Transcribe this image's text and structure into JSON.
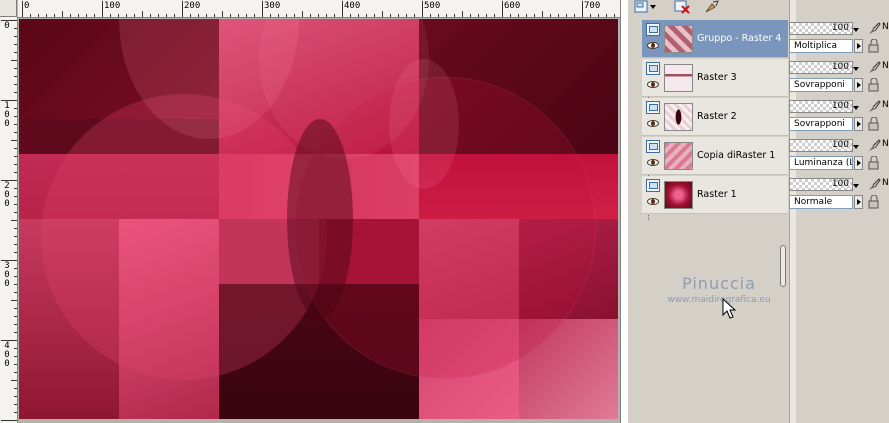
{
  "rulers": {
    "horizontal_labels": [
      "0",
      "100",
      "200",
      "300",
      "400",
      "500",
      "600",
      "700"
    ],
    "vertical_labels": [
      "0",
      "100",
      "200",
      "300",
      "400"
    ]
  },
  "layers": [
    {
      "name": "Gruppo - Raster 4",
      "opacity": "100",
      "blend_mode": "Moltiplica",
      "selected": true
    },
    {
      "name": "Raster 3",
      "opacity": "100",
      "blend_mode": "Sovrapponi",
      "selected": false
    },
    {
      "name": "Raster 2",
      "opacity": "100",
      "blend_mode": "Sovrapponi",
      "selected": false
    },
    {
      "name": "Copia diRaster 1",
      "opacity": "100",
      "blend_mode": "Luminanza (L)",
      "selected": false
    },
    {
      "name": "Raster 1",
      "opacity": "100",
      "blend_mode": "Normale",
      "selected": false
    }
  ],
  "watermark": {
    "name": "Pinuccia",
    "site": "www.maidiregrafica.eu"
  },
  "props_trailing_label": "N",
  "colors": {
    "image_base": "#9c1638",
    "selected_row": "#7a96bc",
    "watermark": "#8d9bb3"
  }
}
